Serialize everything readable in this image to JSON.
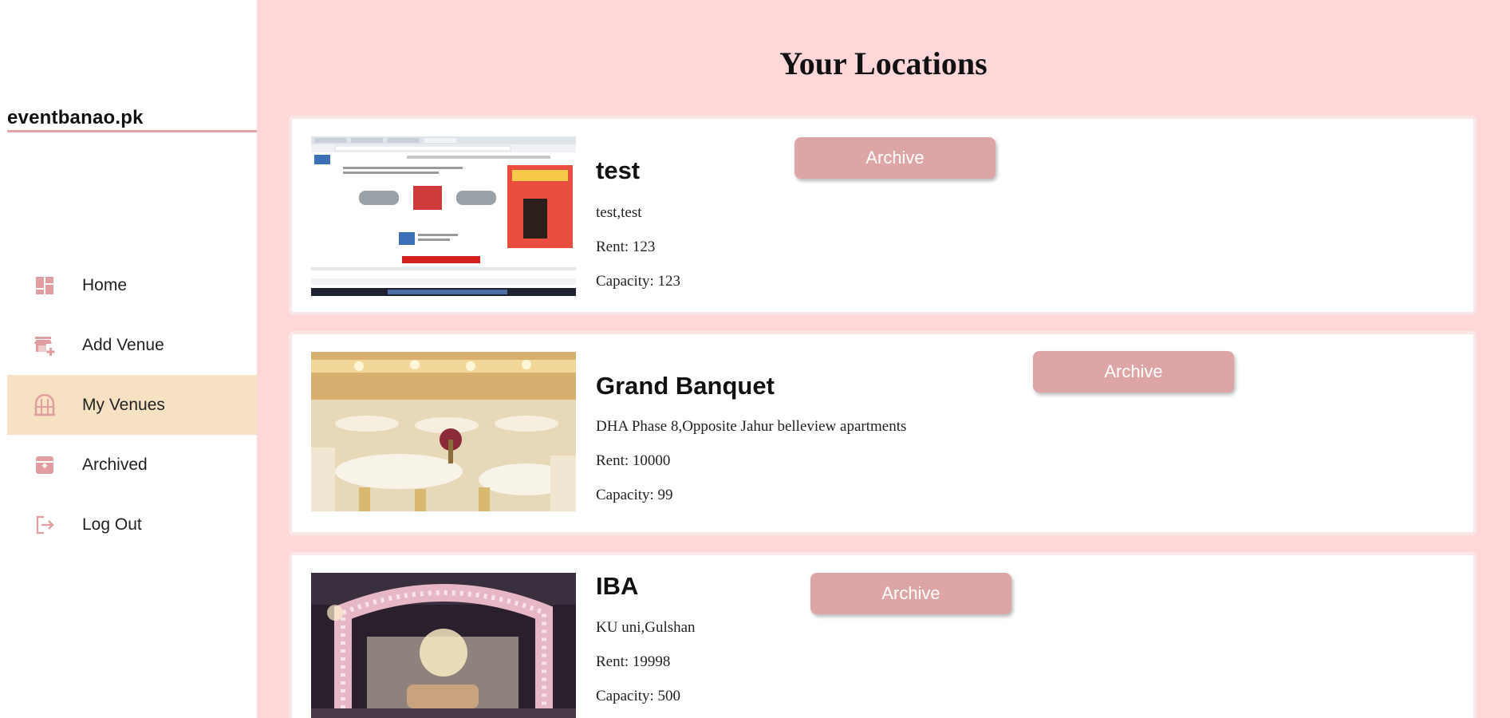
{
  "brand": {
    "name": "eventbanao.pk"
  },
  "sidebar": {
    "items": [
      {
        "label": "Home",
        "icon": "dashboard-icon",
        "active": false
      },
      {
        "label": "Add Venue",
        "icon": "add-store-icon",
        "active": false
      },
      {
        "label": "My Venues",
        "icon": "venue-icon",
        "active": true
      },
      {
        "label": "Archived",
        "icon": "archive-box-icon",
        "active": false
      },
      {
        "label": "Log Out",
        "icon": "logout-icon",
        "active": false
      }
    ]
  },
  "main": {
    "title": "Your Locations",
    "archive_label": "Archive",
    "venues": [
      {
        "name": "test",
        "address": "test,test",
        "rent": "Rent: 123",
        "capacity": "Capacity: 123",
        "image": "screenshot-thumbnail"
      },
      {
        "name": "Grand Banquet",
        "address": "DHA Phase 8,Opposite Jahur belleview apartments",
        "rent": "Rent: 10000",
        "capacity": "Capacity: 99",
        "image": "banquet-hall-photo"
      },
      {
        "name": "IBA",
        "address": "KU uni,Gulshan",
        "rent": "Rent: 19998",
        "capacity": "Capacity: 500",
        "image": "floral-stage-photo"
      }
    ]
  },
  "colors": {
    "background": "#ffd7d9",
    "sidebar": "#ffffff",
    "active_nav": "#f6e1c2",
    "accent": "#dea5a6",
    "icon": "#e09ea0"
  }
}
